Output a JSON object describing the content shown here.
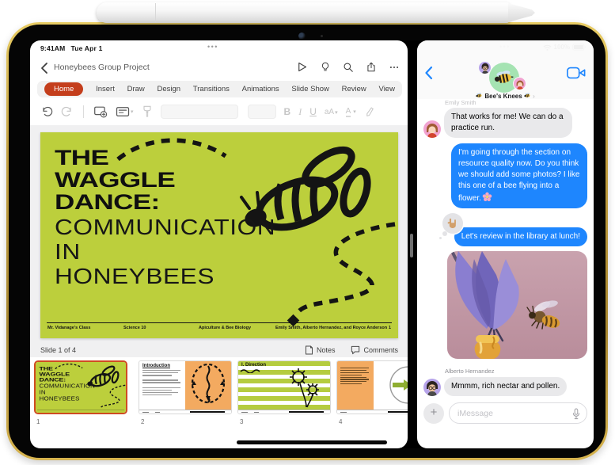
{
  "status_bar": {
    "time": "9:41AM",
    "date": "Tue Apr 1",
    "battery": "100%",
    "left_handle": "•••",
    "right_handle": "•••"
  },
  "powerpoint": {
    "document_title": "Honeybees Group Project",
    "ribbon_tabs": [
      "Home",
      "Insert",
      "Draw",
      "Design",
      "Transitions",
      "Animations",
      "Slide Show",
      "Review",
      "View"
    ],
    "active_tab": "Home",
    "accent_color": "#C43E1C",
    "slide_background": "#BCCF3C",
    "slide": {
      "title_lines": [
        "THE",
        "WAGGLE",
        "DANCE:"
      ],
      "subtitle_lines": [
        "COMMUNICATION",
        "IN",
        "HONEYBEES"
      ],
      "footer_items": [
        "Mr. Vidanage's Class",
        "Science 10",
        "Apiculture & Bee Biology",
        "Emily Smith, Alberto Hernandez, and Royce Anderson"
      ],
      "slide_number": "1"
    },
    "status_row": {
      "slide_counter": "Slide 1 of 4",
      "notes": "Notes",
      "comments": "Comments"
    },
    "thumbnails": [
      {
        "number": "1",
        "selected": true,
        "description": "title-slide"
      },
      {
        "number": "2",
        "selected": false,
        "heading": "Introduction"
      },
      {
        "number": "3",
        "selected": false,
        "heading": "I. Direction"
      },
      {
        "number": "4",
        "selected": false,
        "description": "angle-diagram-slide"
      }
    ]
  },
  "messages": {
    "group_name": "Bee's Knees",
    "group_title_chevron": "›",
    "accent_blue": "#1E86FE",
    "conversation": [
      {
        "sender": "Emily Smith",
        "direction": "incoming",
        "text": "That works for me! We can do a practice run."
      },
      {
        "direction": "outgoing",
        "text": "I'm going through the section on resource quality now. Do you think we should add some photos? I like this one of a bee flying into a flower.",
        "emoji": "cherry-blossom"
      },
      {
        "direction": "outgoing",
        "text": "Let's review in the library at lunch!",
        "tapback": "love-you-gesture"
      },
      {
        "direction": "outgoing",
        "type": "photo",
        "description": "Honeybee flying toward a purple flower",
        "sticker": "honey-pot"
      },
      {
        "sender": "Alberto Hernandez",
        "direction": "incoming",
        "text": "Mmmm, rich nectar and pollen."
      }
    ],
    "composer": {
      "placeholder": "iMessage",
      "add_button": "+"
    }
  }
}
